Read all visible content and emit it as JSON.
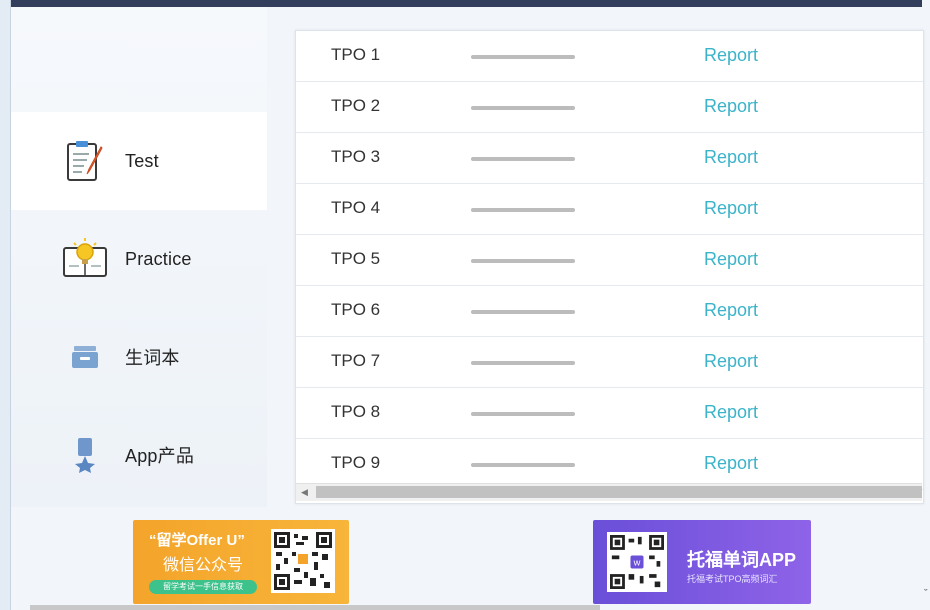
{
  "sidebar": {
    "items": [
      {
        "label": "Test",
        "icon": "clipboard-pencil-icon",
        "active": true
      },
      {
        "label": "Practice",
        "icon": "lightbulb-book-icon",
        "active": false
      },
      {
        "label": "生词本",
        "icon": "vocab-box-icon",
        "active": false
      },
      {
        "label": "App产品",
        "icon": "app-badge-icon",
        "active": false
      }
    ]
  },
  "tpo_list": {
    "link_color": "#3bb3c9",
    "rows": [
      {
        "title": "TPO 1",
        "action": "Report"
      },
      {
        "title": "TPO 2",
        "action": "Report"
      },
      {
        "title": "TPO 3",
        "action": "Report"
      },
      {
        "title": "TPO 4",
        "action": "Report"
      },
      {
        "title": "TPO 5",
        "action": "Report"
      },
      {
        "title": "TPO 6",
        "action": "Report"
      },
      {
        "title": "TPO 7",
        "action": "Report"
      },
      {
        "title": "TPO 8",
        "action": "Report"
      },
      {
        "title": "TPO 9",
        "action": "Report"
      }
    ]
  },
  "banners": {
    "left": {
      "title_line1": "“留学Offer U”",
      "title_line2": "微信公众号",
      "pill": "留学考试一手信息获取"
    },
    "right": {
      "title": "托福单词APP",
      "subtitle": "托福考试TPO高频词汇"
    }
  },
  "scroll": {
    "left_arrow": "◀"
  },
  "corner": {
    "glyph": "ˇ"
  }
}
